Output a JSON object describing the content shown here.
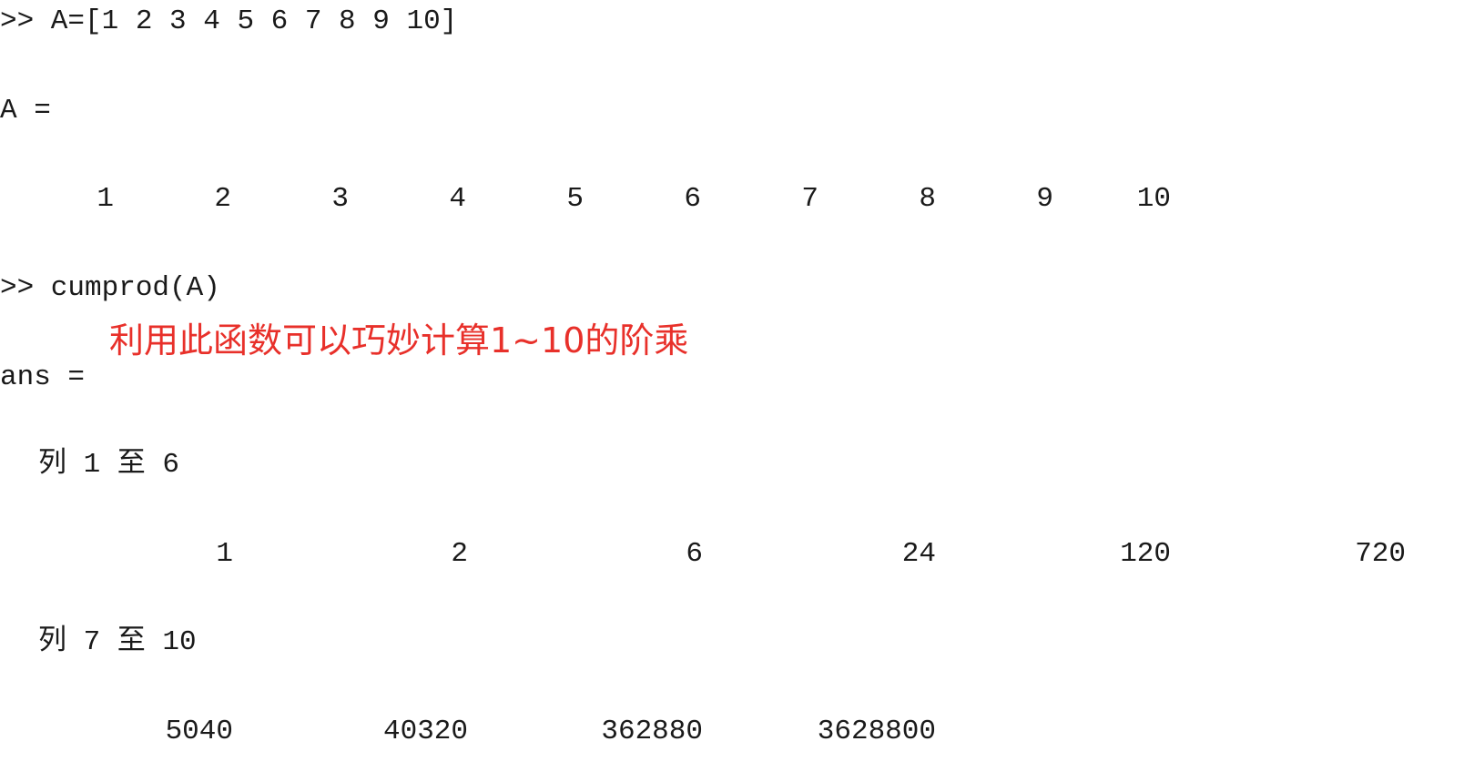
{
  "command1": ">> A=[1 2 3 4 5 6 7 8 9 10]",
  "var_a_header": "A =",
  "a_values": [
    "1",
    "2",
    "3",
    "4",
    "5",
    "6",
    "7",
    "8",
    "9",
    "10"
  ],
  "command2": ">> cumprod(A)",
  "annotation": "利用此函数可以巧妙计算1~10的阶乘",
  "ans_header": "ans =",
  "cols_1_6_label": "列 1 至 6",
  "cols_1_6_values": [
    "1",
    "2",
    "6",
    "24",
    "120",
    "720"
  ],
  "cols_7_10_label": "列 7 至 10",
  "cols_7_10_values": [
    "5040",
    "40320",
    "362880",
    "3628800"
  ]
}
